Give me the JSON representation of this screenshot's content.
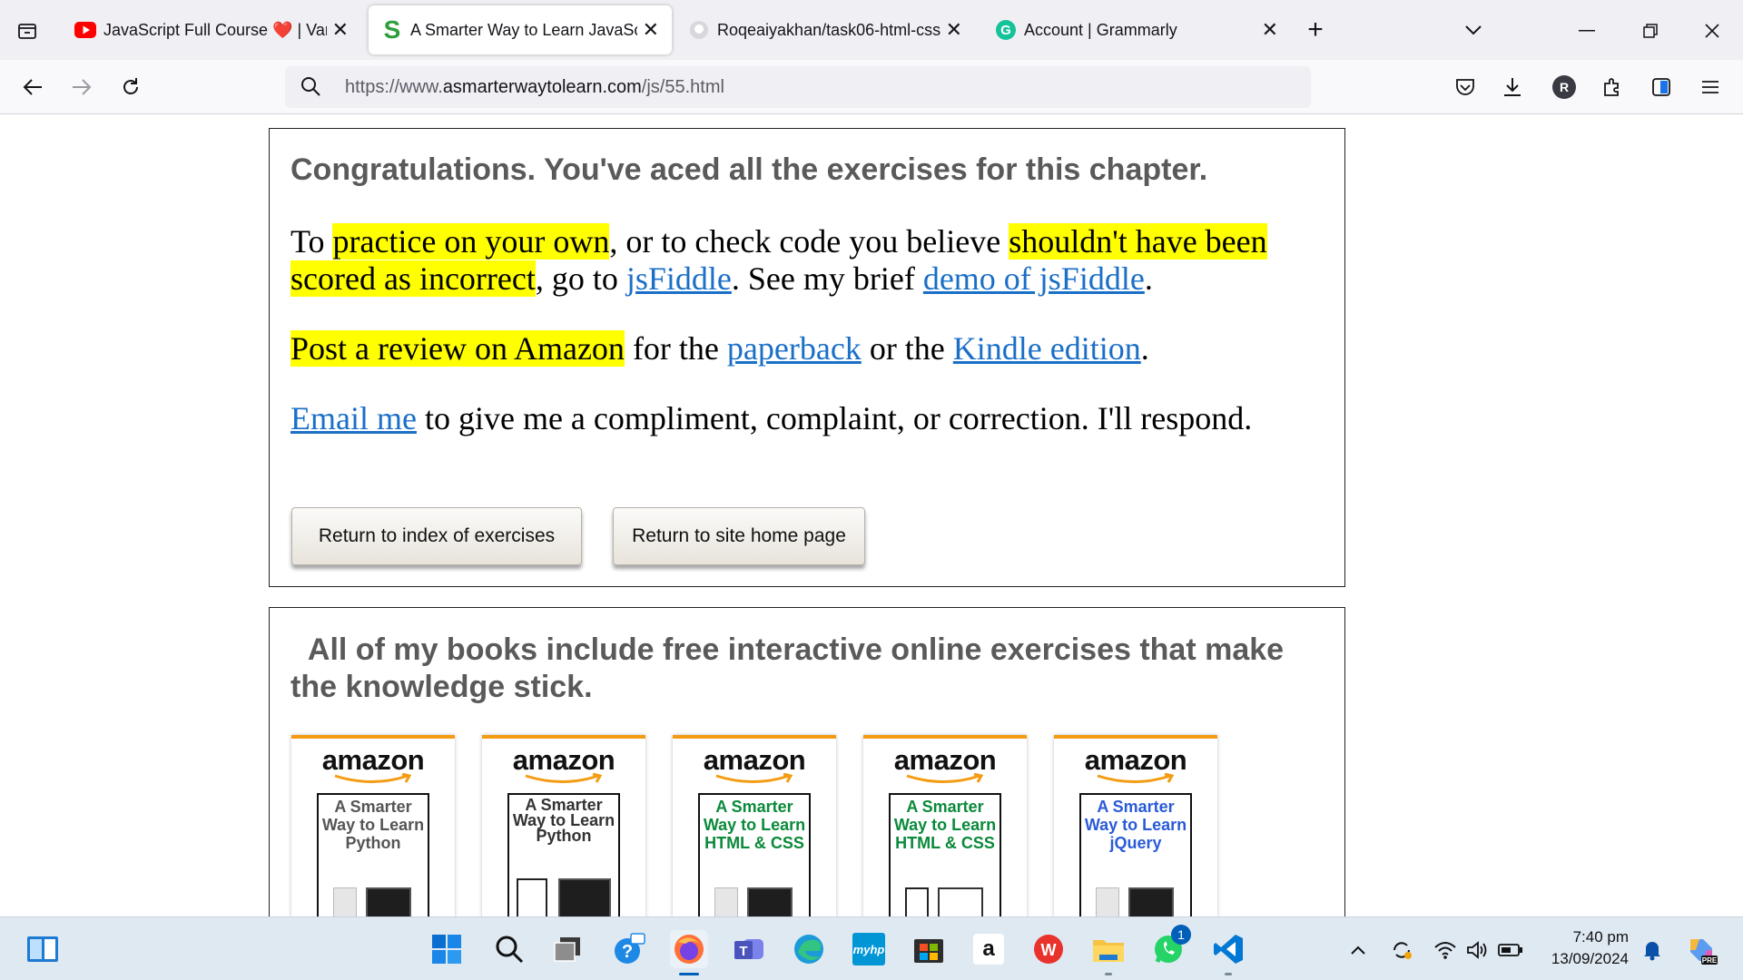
{
  "browser": {
    "tabs": [
      {
        "title": "JavaScript Full Course ❤️ | Varia",
        "favicon": "youtube-icon",
        "active": false
      },
      {
        "title": "A Smarter Way to Learn JavaScr",
        "favicon": "smarter-way-s-icon",
        "active": true
      },
      {
        "title": "Roqeaiyakhan/task06-html-css-",
        "favicon": "github-icon",
        "active": false
      },
      {
        "title": "Account | Grammarly",
        "favicon": "grammarly-icon",
        "active": false
      }
    ],
    "url_prefix": "https://www.",
    "url_domain": "asmarterwaytolearn.com",
    "url_path": "/js/55.html",
    "profile_initial": "R"
  },
  "page": {
    "congrats_heading": "Congratulations. You've aced all the exercises for this chapter.",
    "p1": {
      "t1": "To ",
      "hl1": "practice on your own",
      "t2": ", or to check code you believe ",
      "hl2": "shouldn't have been scored as incorrect",
      "t3": ", go to ",
      "link1": "jsFiddle",
      "t4": ". See my brief ",
      "link2": "demo of jsFiddle",
      "t5": "."
    },
    "p2": {
      "hl": "Post a review on Amazon",
      "t1": " for the ",
      "link1": "paperback",
      "t2": " or the ",
      "link2": "Kindle edition",
      "t3": "."
    },
    "p3": {
      "link": "Email me",
      "t1": " to give me a compliment, complaint, or correction. I'll respond."
    },
    "buttons": {
      "index": "Return to index of exercises",
      "home": "Return to site home page"
    },
    "books_heading": "All of my books include free interactive online exercises that make the knowledge stick.",
    "books": [
      {
        "brand": "amazon",
        "title": "A Smarter Way to Learn Python",
        "color": "#555555"
      },
      {
        "brand": "amazon",
        "title": "A Smarter Way to Learn Python",
        "color": "#333333"
      },
      {
        "brand": "amazon",
        "title": "A Smarter Way to Learn HTML & CSS",
        "color": "#0a8a3a"
      },
      {
        "brand": "amazon",
        "title": "A Smarter Way to Learn HTML & CSS",
        "color": "#0a8a3a"
      },
      {
        "brand": "amazon",
        "title": "A Smarter Way to Learn jQuery",
        "color": "#2a5bd7"
      }
    ]
  },
  "taskbar": {
    "time": "7:40 pm",
    "date": "13/09/2024",
    "whatsapp_badge": "1",
    "myhp_label": "myhp",
    "amazon_label": "a"
  },
  "colors": {
    "highlight": "#ffff00",
    "link": "#1a6fc7",
    "heading": "#5a5a5a",
    "amazon_orange": "#f39c12"
  }
}
